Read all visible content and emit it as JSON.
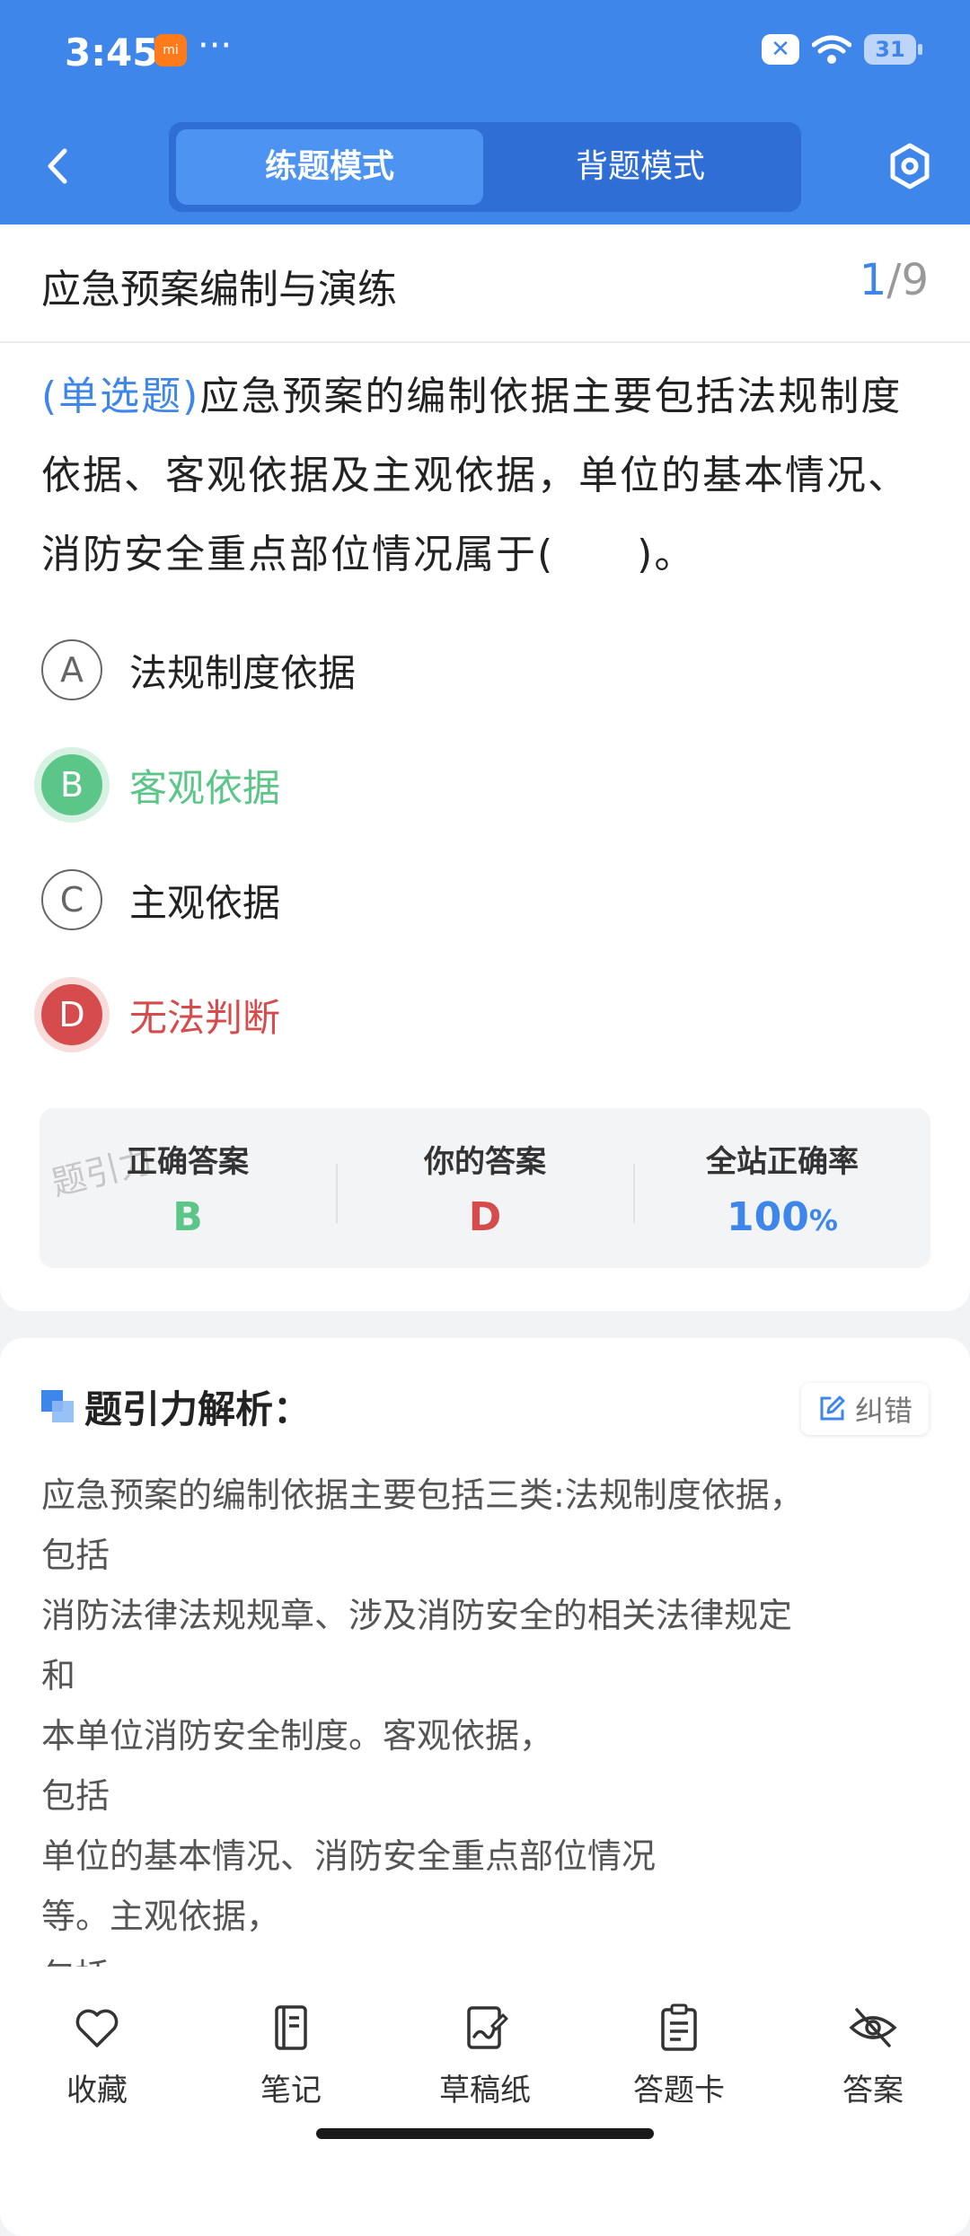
{
  "status_bar": {
    "time": "3:45",
    "mi": "mi",
    "dots": "···",
    "battery": "31"
  },
  "header": {
    "tabs": [
      {
        "label": "练题模式",
        "active": true
      },
      {
        "label": "背题模式",
        "active": false
      }
    ]
  },
  "chapter": {
    "title": "应急预案编制与演练",
    "current": "1",
    "total": "/9"
  },
  "question": {
    "type": "(单选题)",
    "text": "应急预案的编制依据主要包括法规制度依据、客观依据及主观依据，单位的基本情况、消防安全重点部位情况属于(　　)。"
  },
  "options": [
    {
      "letter": "A",
      "text": "法规制度依据",
      "state": "normal"
    },
    {
      "letter": "B",
      "text": "客观依据",
      "state": "correct"
    },
    {
      "letter": "C",
      "text": "主观依据",
      "state": "normal"
    },
    {
      "letter": "D",
      "text": "无法判断",
      "state": "wrong"
    }
  ],
  "stats": {
    "watermark": "题引力",
    "correct_label": "正确答案",
    "correct_value": "B",
    "yours_label": "你的答案",
    "yours_value": "D",
    "rate_label": "全站正确率",
    "rate_value": "100",
    "rate_unit": "%"
  },
  "analysis": {
    "title": "题引力解析：",
    "report_label": "纠错",
    "lines": [
      "应急预案的编制依据主要包括三类:法规制度依据，",
      "包括",
      "消防法律法规规章、涉及消防安全的相关法律规定",
      "和",
      "本单位消防安全制度。客观依据，",
      "包括",
      "单位的基本情况、消防安全重点部位情况",
      "等。主观依据，",
      "包括"
    ]
  },
  "bottom_bar": [
    {
      "label": "收藏",
      "icon": "heart-icon"
    },
    {
      "label": "笔记",
      "icon": "notebook-icon"
    },
    {
      "label": "草稿纸",
      "icon": "draft-icon"
    },
    {
      "label": "答题卡",
      "icon": "clipboard-icon"
    },
    {
      "label": "答案",
      "icon": "eye-off-icon"
    }
  ],
  "colors": {
    "primary": "#3f86ea",
    "correct": "#5cc689",
    "wrong": "#d64b4b"
  }
}
